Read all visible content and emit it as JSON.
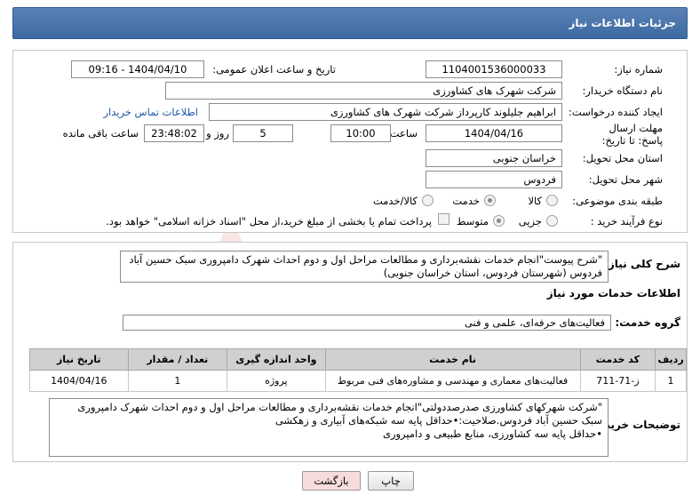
{
  "header": {
    "title": "جزئیات اطلاعات نیاز"
  },
  "form": {
    "need_number_label": "شماره نیاز:",
    "need_number": "1104001536000033",
    "announce_label": "تاریخ و ساعت اعلان عمومی:",
    "announce_value": "1404/04/10 - 09:16",
    "buyer_label": "نام دستگاه خریدار:",
    "buyer_value": "شرکت شهرک های کشاورزی",
    "creator_label": "ایجاد کننده درخواست:",
    "creator_value": "ابراهیم جلیلوند کارپرداز شرکت شهرک های کشاورزی",
    "contact_link": "اطلاعات تماس خریدار",
    "deadline_label": "مهلت ارسال پاسخ: تا تاریخ:",
    "deadline_date": "1404/04/16",
    "time_label": "ساعت",
    "deadline_time": "10:00",
    "days_value": "5",
    "days_label": "روز و",
    "remaining_time": "23:48:02",
    "remaining_label": "ساعت باقی مانده",
    "province_label": "استان محل تحویل:",
    "province_value": "خراسان جنوبی",
    "city_label": "شهر محل تحویل:",
    "city_value": "فردوس",
    "category_label": "طبقه بندی موضوعی:",
    "category_options": [
      "کالا",
      "خدمت",
      "کالا/خدمت"
    ],
    "category_selected": "خدمت",
    "process_label": "نوع فرآیند خرید :",
    "process_options": [
      "جزیی",
      "متوسط"
    ],
    "process_selected": "جزیی",
    "payment_note": "پرداخت تمام یا بخشی از مبلغ خرید،از محل \"اسناد خزانه اسلامی\" خواهد بود."
  },
  "summary": {
    "label": "شرح کلی نیاز:",
    "text": "\"شرح پیوست\"انجام خدمات نقشه‌برداری و مطالعات مراحل اول و دوم احداث شهرک دامپروری سبک حسین آباد فردوس (شهرستان فردوس، استان خراسان جنوبی)"
  },
  "services": {
    "section_title": "اطلاعات خدمات مورد نیاز",
    "group_label": "گروه خدمت:",
    "group_value": "فعالیت‌های حرفه‌ای، علمی و فنی",
    "columns": [
      "ردیف",
      "کد خدمت",
      "نام خدمت",
      "واحد اندازه گیری",
      "تعداد / مقدار",
      "تاریخ نیاز"
    ],
    "rows": [
      [
        "1",
        "ز-71-711",
        "فعالیت‌های معماری و مهندسی و مشاوره‌های فنی مربوط",
        "پروژه",
        "1",
        "1404/04/16"
      ]
    ]
  },
  "buyer_notes": {
    "label": "توضیحات خریدار:",
    "lines": [
      "\"شرکت شهرکهای کشاورزی صدرصددولتی\"انجام خدمات نقشه‌برداری و مطالعات مراحل اول و دوم احداث شهرک دامپروری",
      "سبک حسین آباد فردوس.صلاحیت:•حداقل پایه سه شبکه‌های آبیاری و زهکشی",
      "•حداقل پایه سه کشاورزی، منابع طبیعی و دامپروری"
    ]
  },
  "buttons": {
    "print": "چاپ",
    "back": "بازگشت"
  },
  "colors": {
    "header": "#3d6aa2",
    "link": "#1c57a8",
    "back_button_bg": "#f6dcdc"
  },
  "watermark": "AriaTender.neT"
}
